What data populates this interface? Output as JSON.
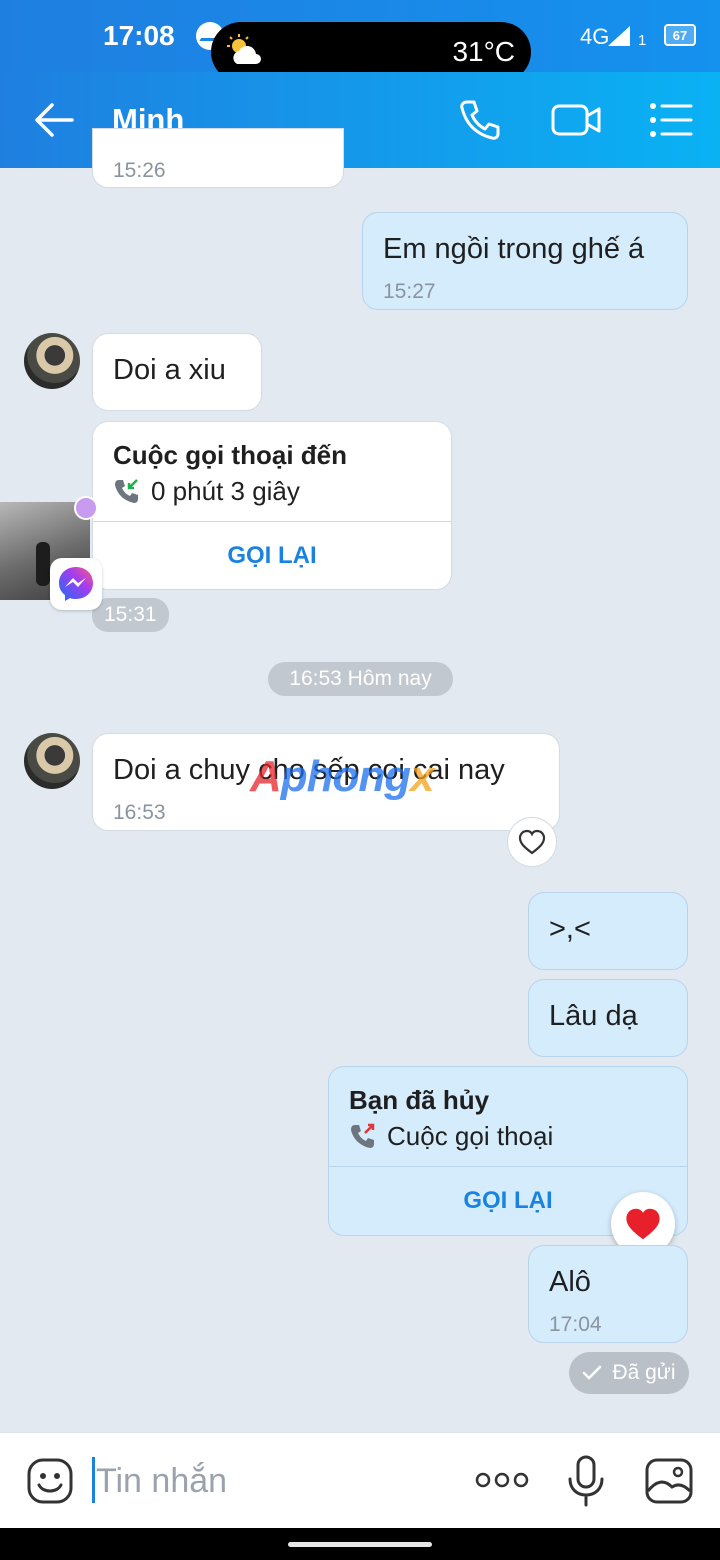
{
  "status_bar": {
    "time": "17:08",
    "temperature": "31°C",
    "network": "4G",
    "sim": "1",
    "battery": "67"
  },
  "header": {
    "contact_name": "Minh",
    "icons": [
      "back-arrow-icon",
      "phone-icon",
      "video-camera-icon",
      "menu-list-icon"
    ]
  },
  "messages": {
    "m0": {
      "time": "15:26"
    },
    "m1": {
      "text": "Em ngồi trong ghế á",
      "time": "15:27"
    },
    "m2": {
      "text": "Doi a xiu"
    },
    "call_in": {
      "title": "Cuộc gọi thoại đến",
      "detail": "0 phút 3 giây",
      "action": "GỌI LẠI",
      "time": "15:31"
    },
    "date_divider": "16:53 Hôm nay",
    "m3": {
      "text": "Doi a chuy cho sếp coi cai nay",
      "time": "16:53"
    },
    "m4": {
      "text": ">,<"
    },
    "m5": {
      "text": "Lâu dạ"
    },
    "call_out": {
      "title": "Bạn đã hủy",
      "detail": "Cuộc gọi thoại",
      "action": "GỌI LẠI"
    },
    "m6": {
      "text": "Alô",
      "time": "17:04"
    },
    "sent_status": "Đã gửi"
  },
  "watermark": {
    "part1": "A",
    "part2": "phong",
    "part3": "x"
  },
  "colors": {
    "header_start": "#1f7fe0",
    "header_end": "#0ab2f4",
    "accent": "#1a83e0",
    "outgoing_bubble": "#d5ecfd",
    "background": "#e2e9f1"
  },
  "composer": {
    "placeholder": "Tin nhắn",
    "value": ""
  }
}
